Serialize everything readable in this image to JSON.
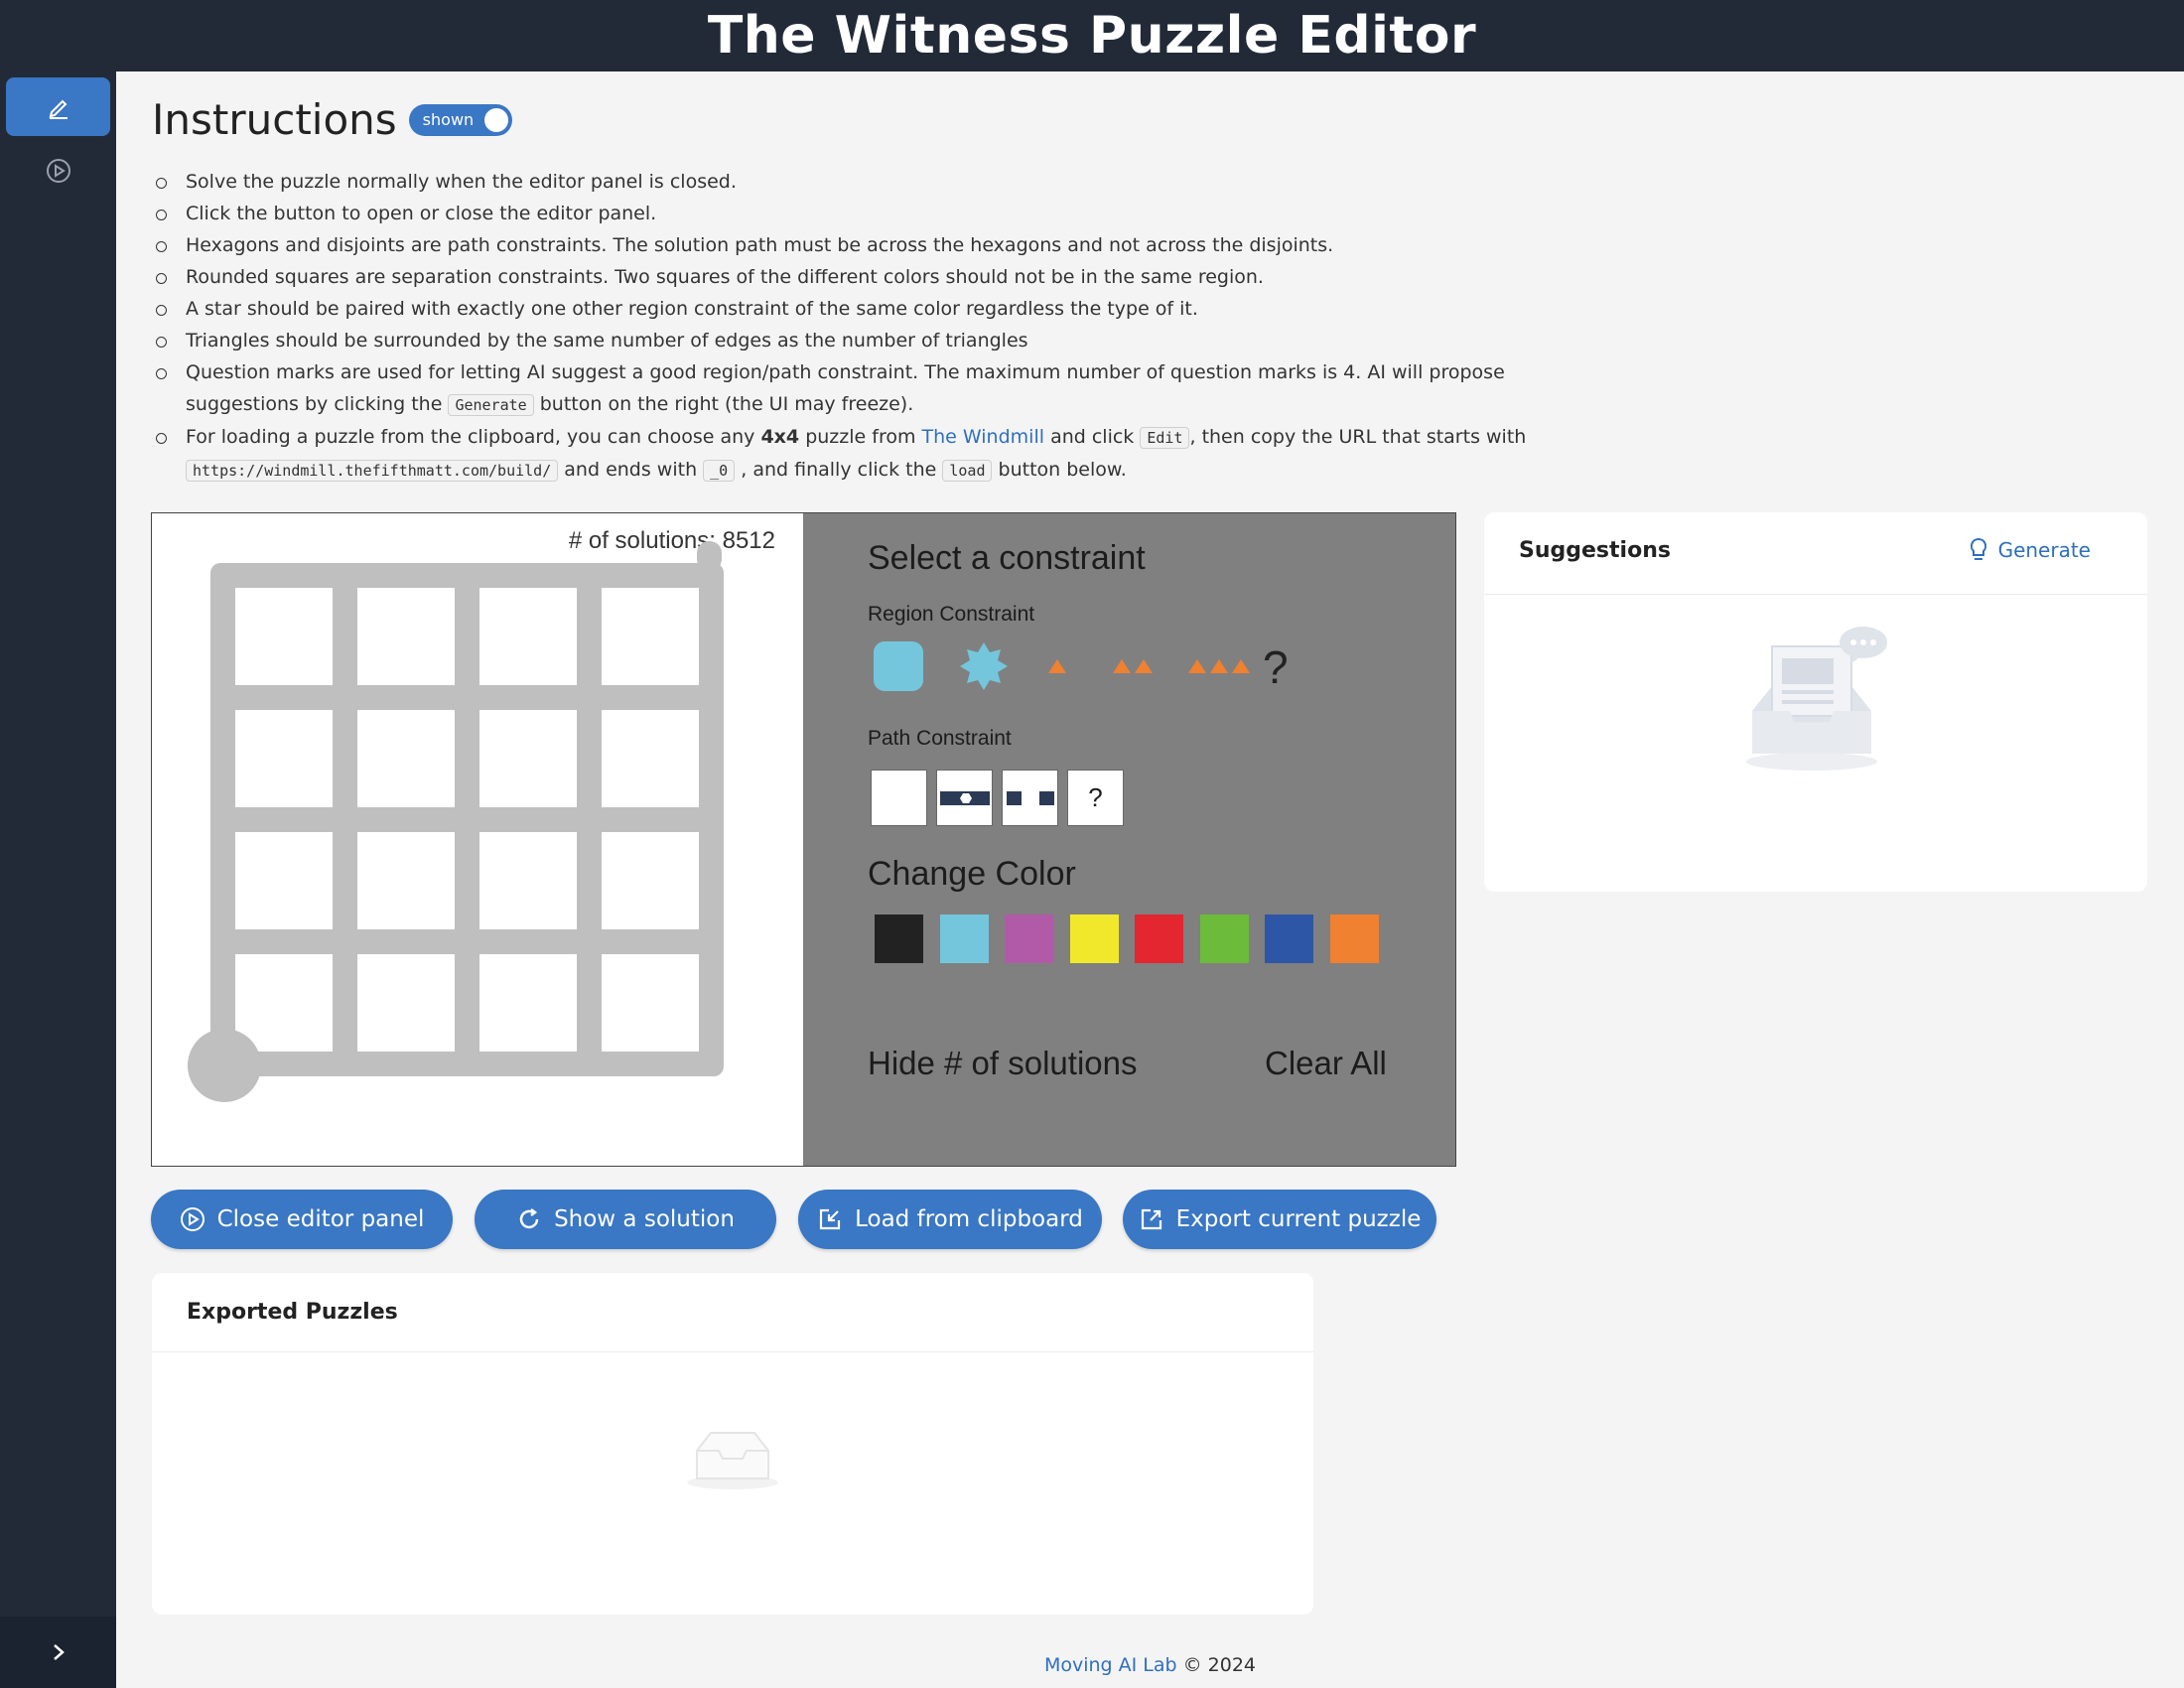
{
  "header": {
    "title": "The Witness Puzzle Editor"
  },
  "sidebar": {
    "items": [
      {
        "icon": "edit-icon"
      },
      {
        "icon": "play-circle-icon"
      }
    ],
    "collapse_icon": "chevron-right-icon"
  },
  "instructions": {
    "heading": "Instructions",
    "toggle_label": "shown",
    "items": {
      "i1": "Solve the puzzle normally when the editor panel is closed.",
      "i2": "Click the button to open or close the editor panel.",
      "i3": "Hexagons and disjoints are path constraints. The solution path must be across the hexagons and not across the disjoints.",
      "i4": "Rounded squares are separation constraints. Two squares of the different colors should not be in the same region.",
      "i5": "A star should be paired with exactly one other region constraint of the same color regardless the type of it.",
      "i6": "Triangles should be surrounded by the same number of edges as the number of triangles",
      "i7a": "Question marks are used for letting AI suggest a good region/path constraint. The maximum number of question marks is 4. AI will propose suggestions by clicking the",
      "i7_code": "Generate",
      "i7b": "button on the right (the UI may freeze).",
      "i8a": "For loading a puzzle from the clipboard, you can choose any",
      "i8_bold": "4x4",
      "i8b": "puzzle from",
      "i8_link": "The Windmill",
      "i8c": "and click",
      "i8_code1": "Edit",
      "i8d": ", then copy the URL that starts with",
      "i8_code2": "https://windmill.thefifthmatt.com/build/",
      "i8e": "and ends with",
      "i8_code3": "_0",
      "i8f": ", and finally click the",
      "i8_code4": "load",
      "i8g": "button below."
    }
  },
  "editor": {
    "solutions_label": "# of solutions: 8512",
    "grid": {
      "rows": 4,
      "cols": 4
    },
    "panel": {
      "select_title": "Select a constraint",
      "region_label": "Region Constraint",
      "region_question": "?",
      "path_label": "Path Constraint",
      "path_question": "?",
      "color_title": "Change Color",
      "colors": [
        "#222222",
        "#74c6dd",
        "#b15aa8",
        "#f2e82b",
        "#e3262f",
        "#6dbb3a",
        "#2d56a6",
        "#ef8130"
      ],
      "constraint_color": "#74c6dd",
      "triangle_color": "#ef8130",
      "hide_label": "Hide # of solutions",
      "clear_label": "Clear All"
    }
  },
  "actions": {
    "close_editor": "Close editor panel",
    "show_solution": "Show a solution",
    "load_clipboard": "Load from clipboard",
    "export_puzzle": "Export current puzzle"
  },
  "suggestions": {
    "title": "Suggestions",
    "generate": "Generate"
  },
  "exported": {
    "title": "Exported Puzzles"
  },
  "footer": {
    "link": "Moving AI Lab",
    "text": "© 2024"
  },
  "theme": {
    "primary": "#3a77c4",
    "sidebar": "#222a38"
  }
}
